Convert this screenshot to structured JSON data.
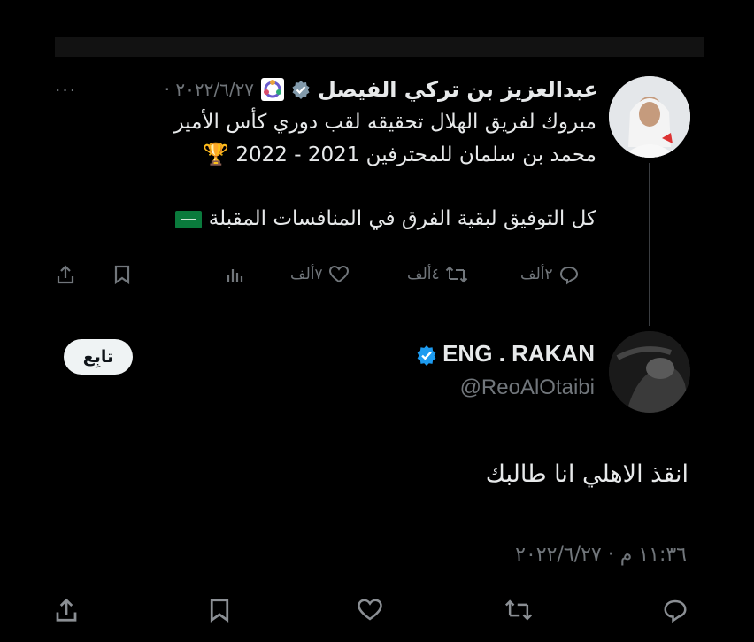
{
  "quoted_tweet": {
    "author_name": "عبدالعزيز بن تركي الفيصل",
    "date": "٢٠٢٢/٦/٢٧ ·",
    "more_label": "···",
    "text_lines": [
      "مبروك لفريق الهلال تحقيقه لقب دوري كأس الأمير",
      "محمد بن سلمان للمحترفين 2021 - 2022",
      "",
      "كل التوفيق لبقية الفرق في المنافسات المقبلة"
    ],
    "trophy_emoji": "🏆",
    "actions": {
      "reply_count": "٢ألف",
      "retweet_count": "٤ألف",
      "like_count": "٧ألف"
    }
  },
  "reply_tweet": {
    "author_name": "ENG . RAKAN",
    "handle": "@ReoAlOtaibi",
    "follow_label": "تابِع",
    "text": "انقذ الاهلي انا طالبك",
    "timestamp": "١١:٣٦ م · ٢٠٢٢/٦/٢٧"
  },
  "colors": {
    "background": "#000000",
    "text": "#e7e9ea",
    "muted": "#71767b",
    "verified": "#1d9bf0",
    "gray_check": "#829aab"
  },
  "icons": {
    "reply": "reply-icon",
    "retweet": "retweet-icon",
    "like": "heart-icon",
    "views": "views-icon",
    "bookmark": "bookmark-icon",
    "share": "share-icon"
  }
}
